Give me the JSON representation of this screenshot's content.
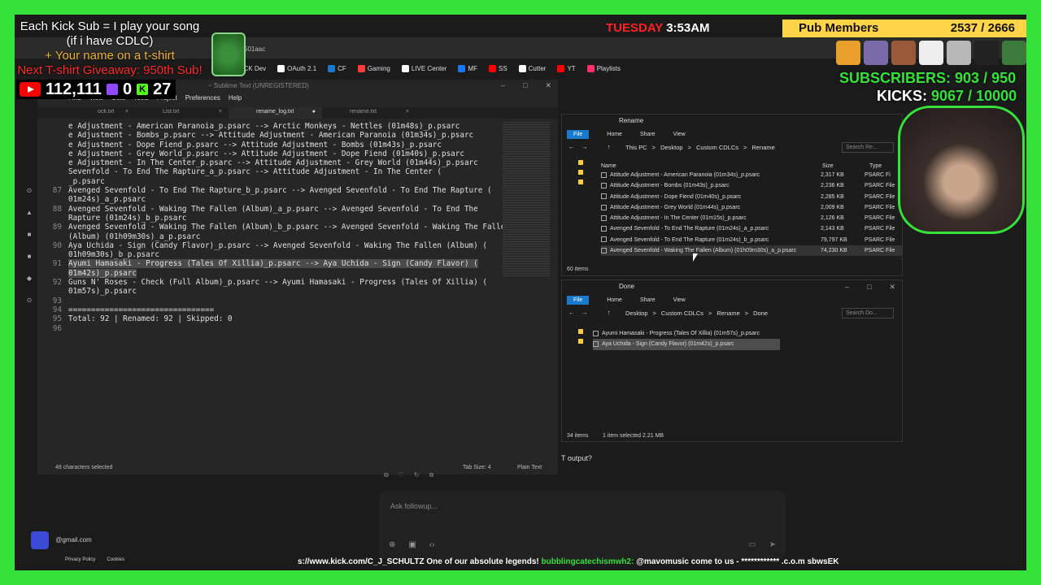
{
  "overlay": {
    "kick_line1": "Each Kick Sub = I play your song",
    "kick_line2": "(if i have CDLC)",
    "kick_line3": "+ Your name on a t-shirt",
    "kick_line4": "Next T-shirt Giveaway: 950th Sub!",
    "youtube_count": "112,111",
    "twitch_count": "0",
    "kick_count": "27",
    "day": "TUESDAY",
    "time": "3:53AM",
    "pub_label": "Pub Members",
    "pub_count": "2537 / 2666",
    "subscribers_label": "SUBSCRIBERS:",
    "subscribers_value": "903 / 950",
    "kicks_label": "KICKS:",
    "kicks_value": "9067 / 10000",
    "ticker": "s://www.kick.com/C_J_SCHULTZ One of our absolute legends!",
    "ticker_user": "bubblingcatechismwh2:",
    "ticker_msg": "@mavomusic come to us - ************ .c.o.m sbwsEK"
  },
  "browser": {
    "address": "501aac",
    "bookmarks": [
      "KICK Dev",
      "OAuth 2.1",
      "CF",
      "Gaming",
      "LIVE Center",
      "MF",
      "SS",
      "Cutter",
      "YT",
      "Playlists"
    ]
  },
  "sublime": {
    "title": "~ Sublime Text (UNREGISTERED)",
    "menu": [
      "Find",
      "View",
      "Goto",
      "Tools",
      "Project",
      "Preferences",
      "Help"
    ],
    "tabs": [
      "ock.txt",
      "List.txt",
      "rename_log.txt",
      "rename.txt"
    ],
    "lines": [
      {
        "n": "",
        "t": "e Adjustment - American Paranoia_p.psarc --> Arctic Monkeys - Nettles (01m48s)_p.psarc"
      },
      {
        "n": "",
        "t": "e Adjustment - Bombs_p.psarc --> Attitude Adjustment - American Paranoia (01m34s)_p.psarc"
      },
      {
        "n": "",
        "t": "e Adjustment - Dope Fiend_p.psarc --> Attitude Adjustment - Bombs (01m43s)_p.psarc"
      },
      {
        "n": "",
        "t": "e Adjustment - Grey World_p.psarc --> Attitude Adjustment - Dope Fiend (01m40s)_p.psarc"
      },
      {
        "n": "",
        "t": "e Adjustment - In The Center_p.psarc --> Attitude Adjustment - Grey World (01m44s)_p.psarc"
      },
      {
        "n": "",
        "t": "Sevenfold - To End The Rapture_a_p.psarc --> Attitude Adjustment - In The Center ("
      },
      {
        "n": "",
        "t": "_p.psarc"
      },
      {
        "n": "87",
        "t": "Avenged Sevenfold - To End The Rapture_b_p.psarc --> Avenged Sevenfold - To End The Rapture ("
      },
      {
        "n": "",
        "t": "01m24s)_a_p.psarc"
      },
      {
        "n": "88",
        "t": "Avenged Sevenfold - Waking The Fallen (Album)_a_p.psarc --> Avenged Sevenfold - To End The"
      },
      {
        "n": "",
        "t": "Rapture (01m24s)_b_p.psarc"
      },
      {
        "n": "89",
        "t": "Avenged Sevenfold - Waking The Fallen (Album)_b_p.psarc --> Avenged Sevenfold - Waking The Fallen"
      },
      {
        "n": "",
        "t": "(Album) (01h09m30s)_a_p.psarc"
      },
      {
        "n": "90",
        "t": "Aya Uchida - Sign (Candy Flavor)_p.psarc --> Avenged Sevenfold - Waking The Fallen (Album) ("
      },
      {
        "n": "",
        "t": "01h09m30s)_b_p.psarc"
      },
      {
        "n": "91",
        "t": "Ayumi Hamasaki - Progress (Tales Of Xillia)_p.psarc --> Aya Uchida - Sign (Candy Flavor) (",
        "hl": true
      },
      {
        "n": "",
        "t": "01m42s)_p.psarc",
        "hl": true
      },
      {
        "n": "92",
        "t": "Guns N' Roses - Check (Full Album)_p.psarc --> Ayumi Hamasaki - Progress (Tales Of Xillia) ("
      },
      {
        "n": "",
        "t": "01m57s)_p.psarc"
      },
      {
        "n": "93",
        "t": ""
      },
      {
        "n": "94",
        "t": "================================"
      },
      {
        "n": "95",
        "t": "Total: 92 | Renamed: 92 | Skipped: 0"
      },
      {
        "n": "96",
        "t": ""
      }
    ],
    "status_left": "48 characters selected",
    "status_tab": "Tab Size: 4",
    "status_syntax": "Plain Text"
  },
  "explorer1": {
    "title": "Rename",
    "tabs": [
      "File",
      "Home",
      "Share",
      "View"
    ],
    "crumbs": [
      "This PC",
      ">",
      "Desktop",
      ">",
      "Custom CDLCs",
      ">",
      "Rename"
    ],
    "search": "Search Re...",
    "col_name": "Name",
    "col_size": "Size",
    "col_type": "Type",
    "rows": [
      {
        "name": "Attitude Adjustment - American Paranoia (01m34s)_p.psarc",
        "size": "2,317 KB",
        "type": "PSARC Fi"
      },
      {
        "name": "Attitude Adjustment - Bombs (01m43s)_p.psarc",
        "size": "2,236 KB",
        "type": "PSARC File"
      },
      {
        "name": "Attitude Adjustment - Dope Fiend (01m40s)_p.psarc",
        "size": "2,285 KB",
        "type": "PSARC File"
      },
      {
        "name": "Attitude Adjustment - Grey World (01m44s)_p.psarc",
        "size": "2,009 KB",
        "type": "PSARC File"
      },
      {
        "name": "Attitude Adjustment - In The Center (01m15s)_p.psarc",
        "size": "2,126 KB",
        "type": "PSARC File"
      },
      {
        "name": "Avenged Sevenfold - To End The Rapture (01m24s)_a_p.psarc",
        "size": "2,143 KB",
        "type": "PSARC File"
      },
      {
        "name": "Avenged Sevenfold - To End The Rapture (01m24s)_b_p.psarc",
        "size": "79,797 KB",
        "type": "PSARC File"
      },
      {
        "name": "Avenged Sevenfold - Waking The Fallen (Album) (01h09m30s)_a_p.psarc",
        "size": "74,230 KB",
        "type": "PSARC File"
      }
    ],
    "status": "60 items"
  },
  "explorer2": {
    "title": "Done",
    "tabs": [
      "File",
      "Home",
      "Share",
      "View"
    ],
    "crumbs": [
      "Desktop",
      ">",
      "Custom CDLCs",
      ">",
      "Rename",
      ">",
      "Done"
    ],
    "search": "Search Do...",
    "rows": [
      {
        "name": "Ayumi Hamasaki - Progress (Tales Of Xillia) (01m57s)_p.psarc"
      },
      {
        "name": "Aya Uchida - Sign (Candy Flavor) (01m42s)_p.psarc"
      }
    ],
    "status_items": "34 items",
    "status_selected": "1 item selected  2.21 MB"
  },
  "chat": {
    "question": "T output?",
    "placeholder": "Ask followup...",
    "email": "@gmail.com",
    "privacy": "Privacy Policy",
    "cookies": "Cookies"
  }
}
